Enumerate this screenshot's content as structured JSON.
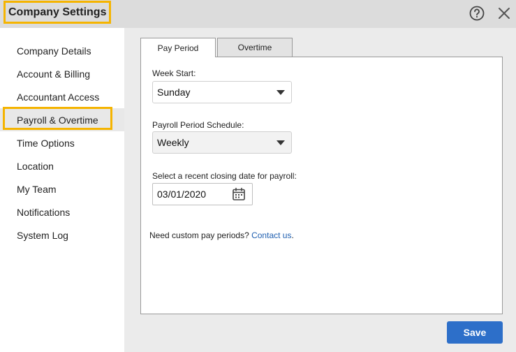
{
  "window": {
    "title": "Company Settings",
    "help_icon": "help-circle-icon",
    "close_icon": "close-icon"
  },
  "sidebar": {
    "items": [
      {
        "label": "Company Details"
      },
      {
        "label": "Account & Billing"
      },
      {
        "label": "Accountant Access"
      },
      {
        "label": "Payroll & Overtime",
        "active": true
      },
      {
        "label": "Time Options"
      },
      {
        "label": "Location"
      },
      {
        "label": "My Team"
      },
      {
        "label": "Notifications"
      },
      {
        "label": "System Log"
      }
    ]
  },
  "tabs": [
    {
      "label": "Pay Period",
      "active": true
    },
    {
      "label": "Overtime",
      "active": false
    }
  ],
  "form": {
    "week_start_label": "Week Start:",
    "week_start_value": "Sunday",
    "schedule_label": "Payroll Period Schedule:",
    "schedule_value": "Weekly",
    "closing_date_label": "Select a recent closing date for payroll:",
    "closing_date_value": "03/01/2020"
  },
  "footnote": {
    "text": "Need custom pay periods? ",
    "link": "Contact us",
    "suffix": "."
  },
  "actions": {
    "save_label": "Save"
  },
  "colors": {
    "accent_highlight": "#f5b400",
    "primary_button": "#2d6fc9",
    "link": "#1f5fb0"
  }
}
